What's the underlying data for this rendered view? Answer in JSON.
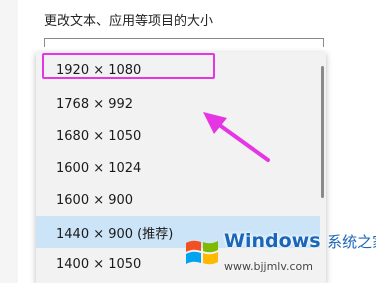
{
  "section_label": "更改文本、应用等项目的大小",
  "resolution_options": [
    "1920 × 1080",
    "1768 × 992",
    "1680 × 1050",
    "1600 × 1024",
    "1600 × 900",
    "1440 × 900 (推荐)",
    "1400 × 1050"
  ],
  "selected_option": "1440 × 900 (推荐)",
  "watermark": {
    "logo_icon": "windows-logo-icon",
    "brand": "Windows",
    "brand_suffix": "系统之家",
    "url": "www.bjjmlv.com"
  },
  "colors": {
    "highlight": "#e535e5",
    "selected_bg": "#cce4f7",
    "brand_blue": "#1a66b8"
  }
}
